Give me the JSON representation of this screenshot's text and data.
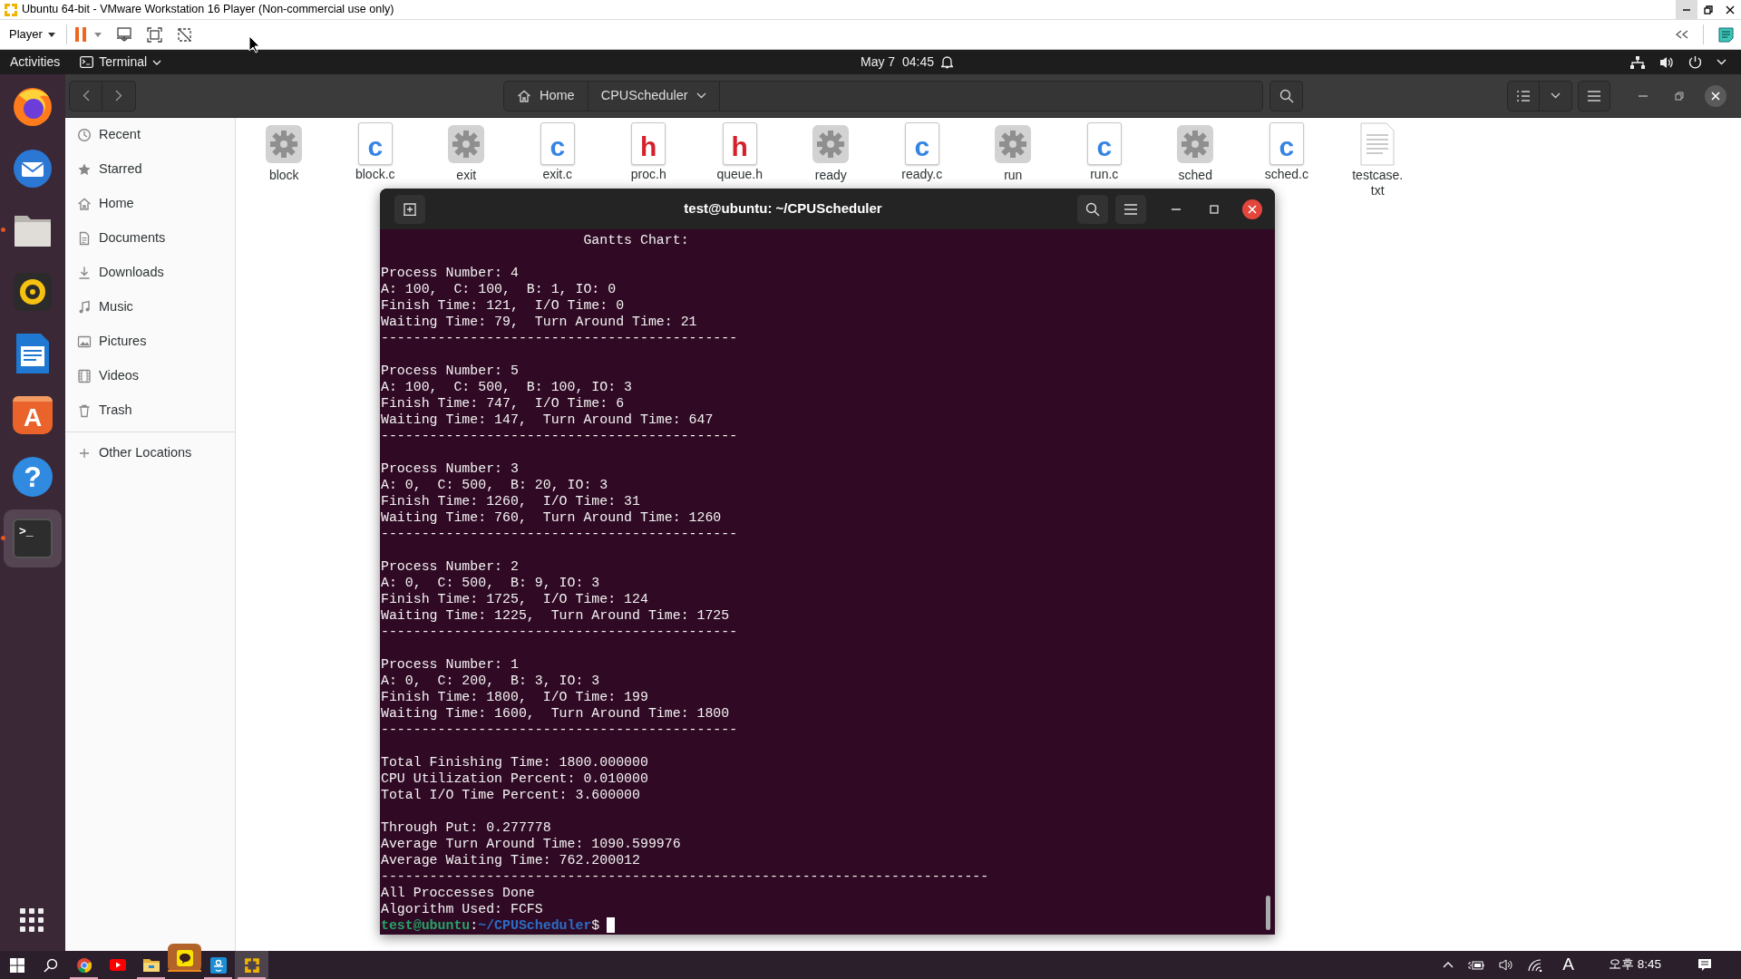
{
  "vm_window": {
    "title": "Ubuntu 64-bit - VMware Workstation 16 Player (Non-commercial use only)",
    "menu_label": "Player"
  },
  "top_bar": {
    "activities": "Activities",
    "app_menu": "Terminal",
    "clock": "May 7  04:45"
  },
  "dock": [
    {
      "kind": "browser",
      "running": false,
      "selected": false
    },
    {
      "kind": "mail",
      "running": false,
      "selected": false
    },
    {
      "kind": "files",
      "running": true,
      "selected": false
    },
    {
      "kind": "music",
      "running": false,
      "selected": false
    },
    {
      "kind": "writer",
      "running": false,
      "selected": false
    },
    {
      "kind": "software",
      "glyph": "A",
      "running": false,
      "selected": false
    },
    {
      "kind": "help",
      "glyph": "?",
      "running": false,
      "selected": false
    },
    {
      "kind": "terminal",
      "glyph": ">_",
      "running": true,
      "selected": true
    }
  ],
  "files": {
    "path": [
      {
        "label": "Home",
        "kind": "home"
      },
      {
        "label": "CPUScheduler",
        "kind": "folder"
      }
    ],
    "places": [
      {
        "label": "Recent",
        "kind": "recent"
      },
      {
        "label": "Starred",
        "kind": "starred"
      },
      {
        "label": "Home",
        "kind": "home"
      },
      {
        "label": "Documents",
        "kind": "documents"
      },
      {
        "label": "Downloads",
        "kind": "downloads"
      },
      {
        "label": "Music",
        "kind": "music"
      },
      {
        "label": "Pictures",
        "kind": "pictures"
      },
      {
        "label": "Videos",
        "kind": "videos"
      },
      {
        "label": "Trash",
        "kind": "trash"
      }
    ],
    "other_locations": "Other Locations",
    "items": [
      {
        "name": "block",
        "kind": "executable"
      },
      {
        "name": "block.c",
        "kind": "source",
        "glyph": "c"
      },
      {
        "name": "exit",
        "kind": "executable"
      },
      {
        "name": "exit.c",
        "kind": "source",
        "glyph": "c"
      },
      {
        "name": "proc.h",
        "kind": "header",
        "glyph": "h"
      },
      {
        "name": "queue.h",
        "kind": "header",
        "glyph": "h"
      },
      {
        "name": "ready",
        "kind": "executable"
      },
      {
        "name": "ready.c",
        "kind": "source",
        "glyph": "c"
      },
      {
        "name": "run",
        "kind": "executable"
      },
      {
        "name": "run.c",
        "kind": "source",
        "glyph": "c"
      },
      {
        "name": "sched",
        "kind": "executable"
      },
      {
        "name": "sched.c",
        "kind": "source",
        "glyph": "c"
      },
      {
        "name": "testcase.txt",
        "kind": "text"
      }
    ]
  },
  "terminal": {
    "title": "test@ubuntu: ~/CPUScheduler",
    "blocks": [
      [
        "                         Gantts Chart:"
      ],
      [
        "Process Number: 4",
        "A: 100,  C: 100,  B: 1, IO: 0",
        "Finish Time: 121,  I/O Time: 0",
        "Waiting Time: 79,  Turn Around Time: 21",
        "--------------------------------------------"
      ],
      [
        "Process Number: 5",
        "A: 100,  C: 500,  B: 100, IO: 3",
        "Finish Time: 747,  I/O Time: 6",
        "Waiting Time: 147,  Turn Around Time: 647",
        "--------------------------------------------"
      ],
      [
        "Process Number: 3",
        "A: 0,  C: 500,  B: 20, IO: 3",
        "Finish Time: 1260,  I/O Time: 31",
        "Waiting Time: 760,  Turn Around Time: 1260",
        "--------------------------------------------"
      ],
      [
        "Process Number: 2",
        "A: 0,  C: 500,  B: 9, IO: 3",
        "Finish Time: 1725,  I/O Time: 124",
        "Waiting Time: 1225,  Turn Around Time: 1725",
        "--------------------------------------------"
      ],
      [
        "Process Number: 1",
        "A: 0,  C: 200,  B: 3, IO: 3",
        "Finish Time: 1800,  I/O Time: 199",
        "Waiting Time: 1600,  Turn Around Time: 1800",
        "--------------------------------------------"
      ],
      [
        "Total Finishing Time: 1800.000000",
        "CPU Utilization Percent: 0.010000",
        "Total I/O Time Percent: 3.600000"
      ],
      [
        "Through Put: 0.277778",
        "Average Turn Around Time: 1090.599976",
        "Average Waiting Time: 762.200012",
        "---------------------------------------------------------------------------",
        "All Proccesses Done",
        "Algorithm Used: FCFS"
      ]
    ],
    "prompt": {
      "user": "test@ubuntu",
      "separator": ":",
      "path": "~/CPUScheduler",
      "symbol": "$"
    }
  },
  "taskbar": {
    "apps": [
      {
        "kind": "start",
        "running": false,
        "alert": false,
        "selected": false
      },
      {
        "kind": "search",
        "running": false,
        "alert": false,
        "selected": false
      },
      {
        "kind": "browser",
        "running": true,
        "alert": false,
        "selected": false
      },
      {
        "kind": "video",
        "running": false,
        "alert": false,
        "selected": false
      },
      {
        "kind": "explorer",
        "running": true,
        "alert": false,
        "selected": false
      },
      {
        "kind": "chat",
        "running": true,
        "alert": true,
        "selected": false
      },
      {
        "kind": "app",
        "running": true,
        "alert": false,
        "selected": false
      },
      {
        "kind": "vmware",
        "running": true,
        "alert": false,
        "selected": true
      }
    ],
    "ime": "A",
    "clock": "오후 8:45"
  }
}
